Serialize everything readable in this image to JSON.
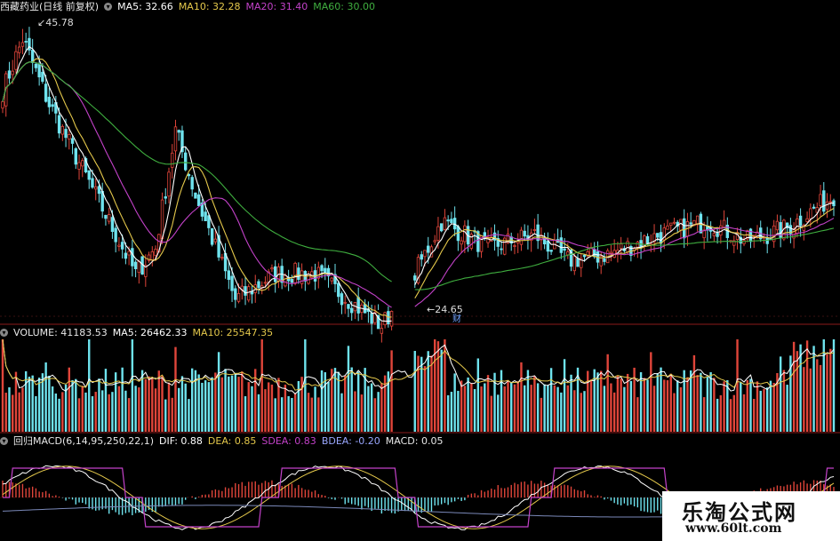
{
  "main_header": {
    "title": "西藏药业(日线 前复权)",
    "ma5": "MA5: 32.66",
    "ma10": "MA10: 32.28",
    "ma20": "MA20: 31.40",
    "ma60": "MA60: 30.00"
  },
  "price_labels": {
    "high": "45.78",
    "low": "24.65",
    "cai": "财"
  },
  "volume_header": {
    "volume": "VOLUME: 41183.53",
    "ma5": "MA5: 26462.33",
    "ma10": "MA10: 25547.35"
  },
  "macd_header": {
    "name": "回归MACD(6,14,95,250,22,1)",
    "dif": "DIF: 0.88",
    "dea": "DEA: 0.85",
    "sdea": "SDEA: 0.83",
    "bdea": "BDEA: -0.20",
    "macd": "MACD: 0.05"
  },
  "watermark": {
    "name": "乐淘公式网",
    "url": "www.60lt.com"
  },
  "colors": {
    "up": "#e0453a",
    "down": "#6fe3ee",
    "ma5": "#ffffff",
    "ma10": "#e4c84b",
    "ma20": "#c342c9",
    "ma60": "#3fae3f",
    "divider": "#8b1a1a",
    "grid": "#3a1010"
  },
  "chart_data": {
    "type": "candlestick",
    "panels": [
      "price",
      "volume",
      "macd"
    ],
    "price_anchors": [
      {
        "bar": 0,
        "close": 41
      },
      {
        "bar": 6,
        "close": 45
      },
      {
        "bar": 14,
        "close": 40
      },
      {
        "bar": 28,
        "close": 33
      },
      {
        "bar": 40,
        "close": 27
      },
      {
        "bar": 46,
        "close": 29
      },
      {
        "bar": 52,
        "close": 38
      },
      {
        "bar": 58,
        "close": 33
      },
      {
        "bar": 70,
        "close": 25
      },
      {
        "bar": 82,
        "close": 27
      },
      {
        "bar": 94,
        "close": 27
      },
      {
        "bar": 104,
        "close": 25
      },
      {
        "bar": 114,
        "close": 23
      },
      {
        "bar": 122,
        "close": 26
      },
      {
        "bar": 132,
        "close": 31
      },
      {
        "bar": 146,
        "close": 29
      },
      {
        "bar": 160,
        "close": 30
      },
      {
        "bar": 170,
        "close": 28
      },
      {
        "bar": 182,
        "close": 28.5
      },
      {
        "bar": 198,
        "close": 30
      },
      {
        "bar": 212,
        "close": 31
      },
      {
        "bar": 224,
        "close": 29.5
      },
      {
        "bar": 236,
        "close": 30.5
      },
      {
        "bar": 250,
        "close": 33
      }
    ],
    "gap_after_bar": 124,
    "price_high": 45.78,
    "price_low": 24.65,
    "last_values": {
      "ma5": 32.66,
      "ma10": 32.28,
      "ma20": 31.4,
      "ma60": 30.0,
      "volume": 41183.53,
      "volume_ma5": 26462.33,
      "volume_ma10": 25547.35,
      "dif": 0.88,
      "dea": 0.85,
      "sdea": 0.83,
      "bdea": -0.2,
      "macd": 0.05
    }
  }
}
